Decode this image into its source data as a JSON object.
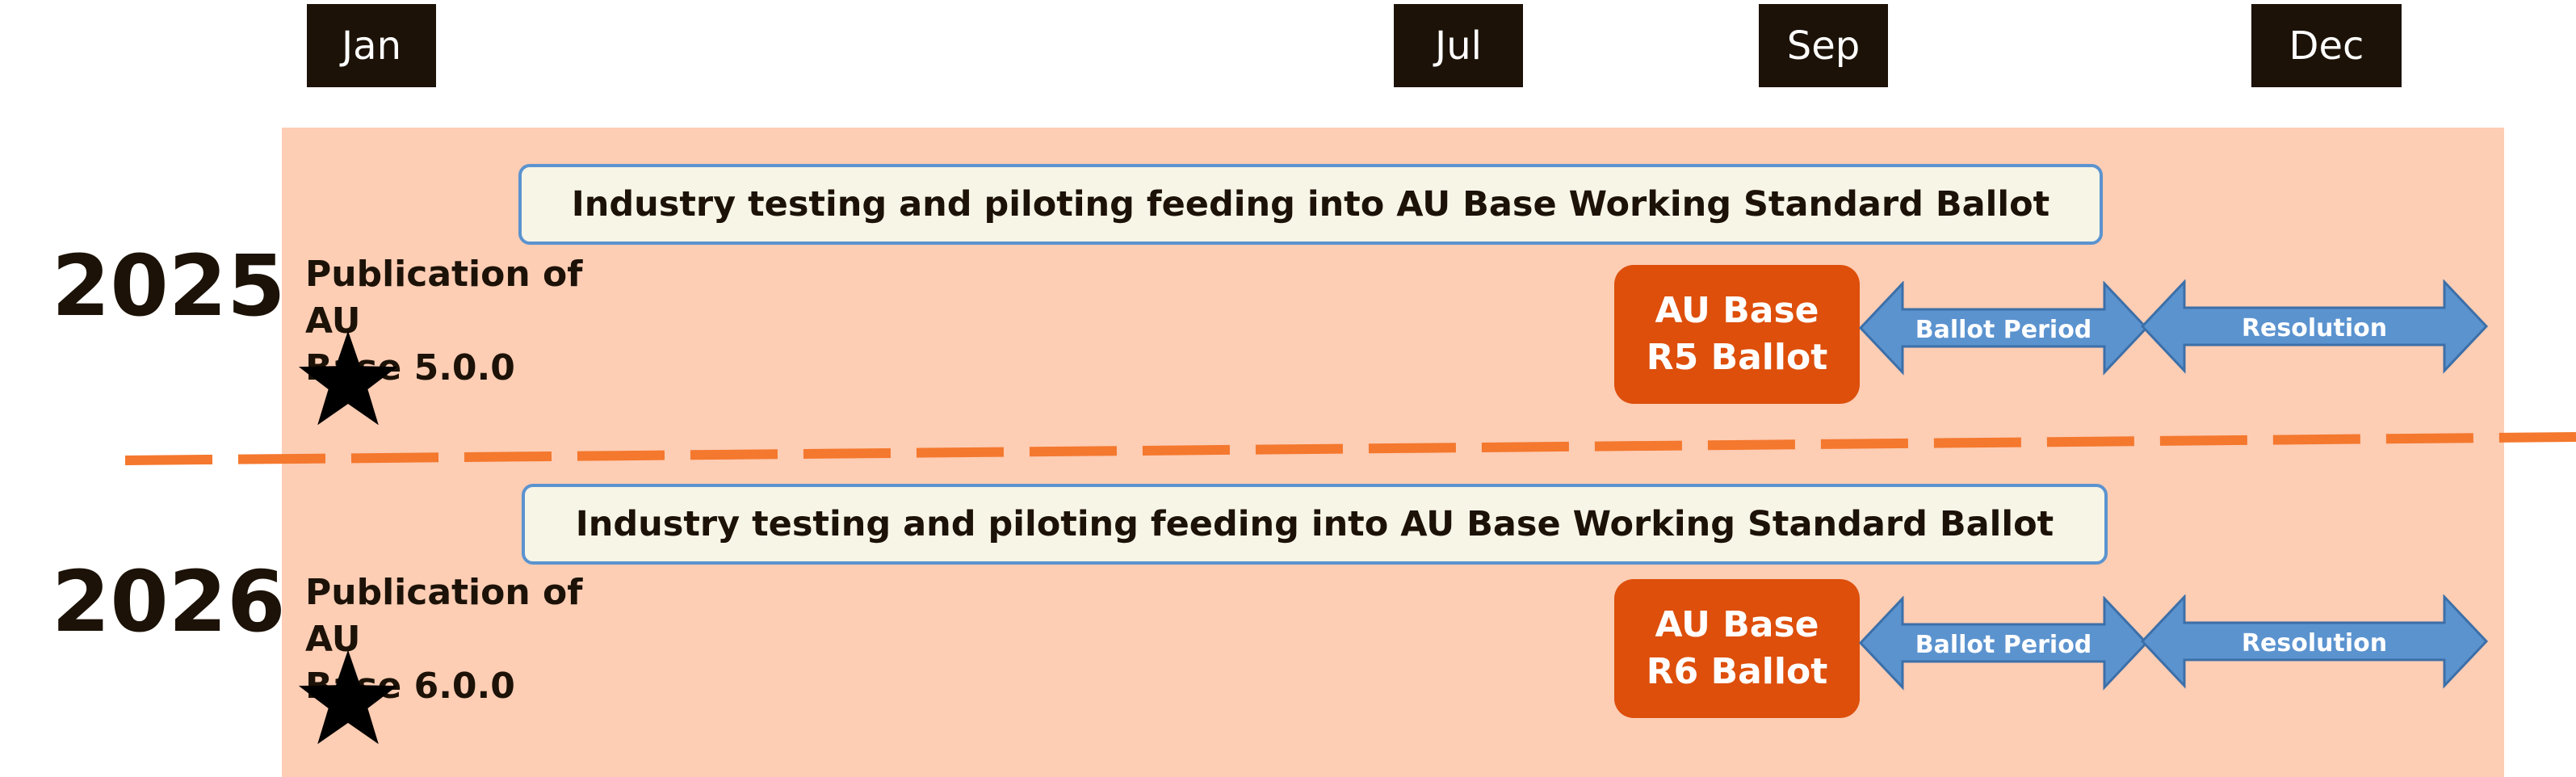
{
  "timeline": {
    "months": [
      {
        "label": "Jan"
      },
      {
        "label": "Jul"
      },
      {
        "label": "Sep"
      },
      {
        "label": "Dec"
      }
    ]
  },
  "rows": [
    {
      "year": "2025",
      "publication_line1": "Publication of AU",
      "publication_line2": "Base 5.0.0",
      "testing": "Industry testing and piloting feeding into AU Base Working Standard Ballot",
      "ballot_line1": "AU Base",
      "ballot_line2": "R5 Ballot",
      "ballot_period": "Ballot Period",
      "resolution": "Resolution"
    },
    {
      "year": "2026",
      "publication_line1": "Publication of AU",
      "publication_line2": "Base 6.0.0",
      "testing": "Industry testing and piloting feeding into AU Base Working Standard Ballot",
      "ballot_line1": "AU Base",
      "ballot_line2": "R6 Ballot",
      "ballot_period": "Ballot Period",
      "resolution": "Resolution"
    }
  ],
  "colors": {
    "band": "#fdcdb4",
    "month_box": "#1c1207",
    "ballot_box": "#dd4f0b",
    "arrow": "#5b93cf",
    "divider": "#f4782e",
    "testing_fill": "#f7f5e6"
  }
}
